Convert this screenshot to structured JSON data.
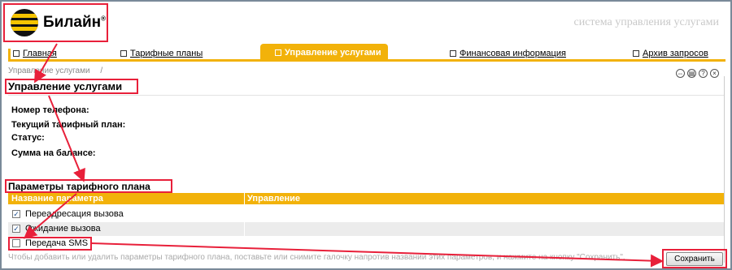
{
  "logo": {
    "text": "Билайн",
    "mark": "®"
  },
  "tagline": "система управления услугами",
  "nav": [
    {
      "label": "Главная",
      "icon": "home-icon"
    },
    {
      "label": "Тарифные планы",
      "icon": "document-icon"
    },
    {
      "label": "Управление услугами",
      "icon": "services-icon",
      "active": true
    },
    {
      "label": "Финансовая информация",
      "icon": "finance-icon"
    },
    {
      "label": "Архив запросов",
      "icon": "archive-icon"
    }
  ],
  "breadcrumb": {
    "item": "Управление услугами",
    "sep": "/"
  },
  "tools": [
    {
      "name": "link-icon",
      "glyph": "⇔"
    },
    {
      "name": "print-icon",
      "glyph": "▤"
    },
    {
      "name": "help-icon",
      "glyph": "?"
    },
    {
      "name": "close-icon",
      "glyph": "×"
    }
  ],
  "page_title": "Управление услугами",
  "fields": {
    "phone_label": "Номер телефона:",
    "plan_label": "Текущий тарифный план:",
    "status_label": "Статус:",
    "balance_label": "Сумма на балансе:"
  },
  "params": {
    "title": "Параметры тарифного плана",
    "col_name": "Название параметра",
    "col_manage": "Управление",
    "rows": [
      {
        "label": "Переадресация вызова",
        "checked": true
      },
      {
        "label": "Ожидание вызова",
        "checked": true
      },
      {
        "label": "Передача SMS",
        "checked": false
      }
    ]
  },
  "hint": "Чтобы добавить или удалить параметры тарифного плана, поставьте или снимите галочку напротив названий этих параметров, и нажмите на кнопку \"Сохранить\".",
  "save_label": "Сохранить",
  "colors": {
    "accent": "#f2b20a",
    "annotation": "#e8203a"
  }
}
